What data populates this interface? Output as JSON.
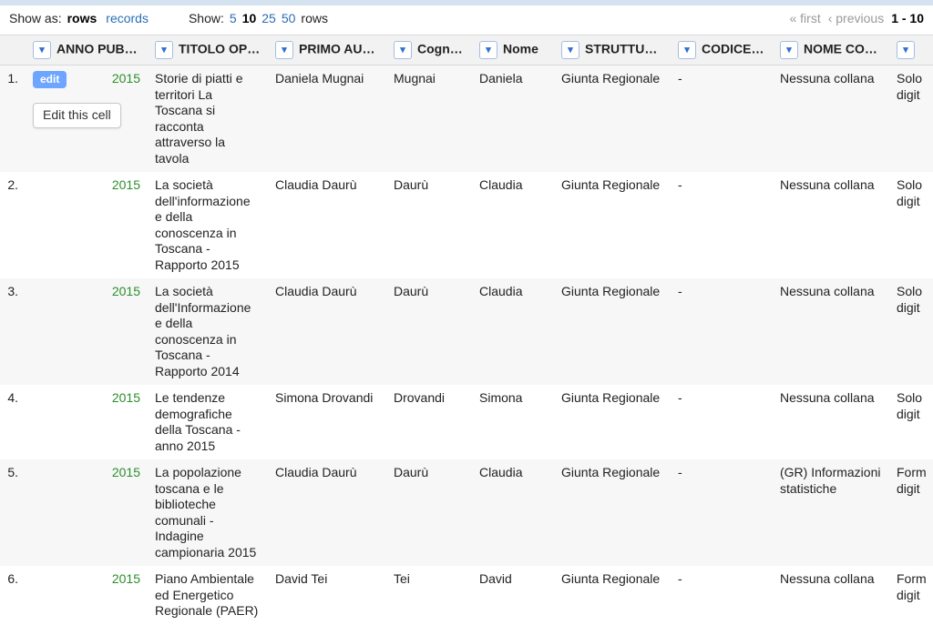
{
  "toolbar": {
    "show_as_label": "Show as:",
    "mode_rows": "rows",
    "mode_records": "records",
    "show_label": "Show:",
    "page_sizes": [
      "5",
      "10",
      "25",
      "50"
    ],
    "selected_page_size": "10",
    "rows_label": "rows",
    "first": "« first",
    "previous": "‹ previous",
    "range": "1 - 10"
  },
  "columns": [
    "ANNO PUBBLIC.",
    "TITOLO OPERA",
    "PRIMO AUTORE",
    "Cognome",
    "Nome",
    "STRUTTURA CH",
    "CODICE ISBN",
    "NOME COLLANA",
    ""
  ],
  "edit": {
    "pill": "edit",
    "tooltip": "Edit this cell"
  },
  "rows": [
    {
      "n": "1.",
      "anno": "2015",
      "titolo": "Storie di piatti e territori La Toscana si racconta attraverso la tavola",
      "primo": "Daniela Mugnai",
      "cognome": "Mugnai",
      "nome": "Daniela",
      "strutt": "Giunta Regionale",
      "isbn": "-",
      "collana": "Nessuna collana",
      "extra": "Solo digit"
    },
    {
      "n": "2.",
      "anno": "2015",
      "titolo": "La società dell'informazione e della conoscenza in Toscana - Rapporto 2015",
      "primo": "Claudia Daurù",
      "cognome": "Daurù",
      "nome": "Claudia",
      "strutt": "Giunta Regionale",
      "isbn": "-",
      "collana": "Nessuna collana",
      "extra": "Solo digit"
    },
    {
      "n": "3.",
      "anno": "2015",
      "titolo": "La società dell'Informazione e della conoscenza in Toscana - Rapporto 2014",
      "primo": "Claudia Daurù",
      "cognome": "Daurù",
      "nome": "Claudia",
      "strutt": "Giunta Regionale",
      "isbn": "-",
      "collana": "Nessuna collana",
      "extra": "Solo digit"
    },
    {
      "n": "4.",
      "anno": "2015",
      "titolo": "Le tendenze demografiche della Toscana - anno 2015",
      "primo": "Simona Drovandi",
      "cognome": "Drovandi",
      "nome": "Simona",
      "strutt": "Giunta Regionale",
      "isbn": "-",
      "collana": "Nessuna collana",
      "extra": "Solo digit"
    },
    {
      "n": "5.",
      "anno": "2015",
      "titolo": "La popolazione toscana e le biblioteche comunali - Indagine campionaria 2015",
      "primo": "Claudia Daurù",
      "cognome": "Daurù",
      "nome": "Claudia",
      "strutt": "Giunta Regionale",
      "isbn": "-",
      "collana": "(GR) Informazioni statistiche",
      "extra": "Form digit"
    },
    {
      "n": "6.",
      "anno": "2015",
      "titolo": "Piano Ambientale ed Energetico Regionale (PAER)",
      "primo": "David Tei",
      "cognome": "Tei",
      "nome": "David",
      "strutt": "Giunta Regionale",
      "isbn": "-",
      "collana": "Nessuna collana",
      "extra": "Form digit"
    }
  ]
}
